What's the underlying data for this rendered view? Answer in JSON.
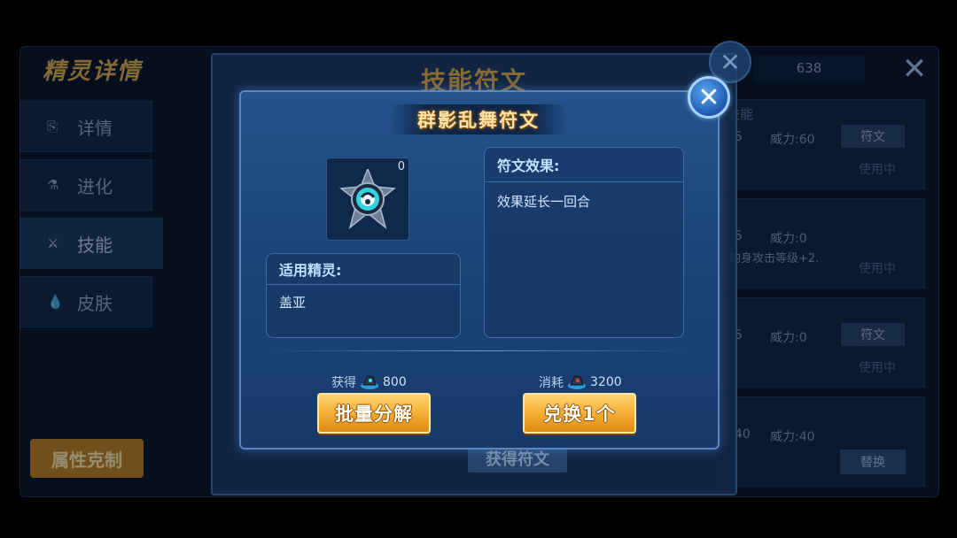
{
  "background": {
    "page_title": "精灵详情",
    "sidebar": [
      {
        "icon": "document-icon",
        "glyph": "⎘",
        "label": "详情"
      },
      {
        "icon": "flask-icon",
        "glyph": "⚗",
        "label": "进化"
      },
      {
        "icon": "sword-icon",
        "glyph": "⚔",
        "label": "技能",
        "active": true
      },
      {
        "icon": "drop-icon",
        "glyph": "💧",
        "label": "皮肤"
      }
    ],
    "attribute_button": "属性克制",
    "count_display": "638",
    "skill_head": "技能",
    "skill_cards": [
      {
        "col1": "5",
        "col2": "威力:60",
        "button": "符文",
        "status": "使用中",
        "extra": ""
      },
      {
        "col1": "5",
        "col2": "威力:0",
        "button": "",
        "status": "使用中",
        "extra": "的身攻击等级+2."
      },
      {
        "col1": "5",
        "col2": "威力:0",
        "button": "符文",
        "status": "使用中",
        "extra": ""
      },
      {
        "col1": "40",
        "col2": "威力:40",
        "button": "",
        "status": "",
        "extra": ""
      }
    ],
    "dismantle_button": "替换"
  },
  "mid_dialog": {
    "title": "技能符文",
    "get_rune_button": "获得符文"
  },
  "rune_dialog": {
    "title": "群影乱舞符文",
    "rune_count": "0",
    "applicable_label": "适用精灵:",
    "applicable_value": "盖亚",
    "effect_label": "符文效果:",
    "effect_value": "效果延长一回合",
    "obtain_label": "获得",
    "obtain_amount": "800",
    "cost_label": "消耗",
    "cost_amount": "3200",
    "decompose_button": "批量分解",
    "exchange_button": "兑换1个"
  },
  "colors": {
    "accent_gold": "#f7b23a",
    "dialog_blue": "#1c4478",
    "title_glow": "#ffe2a8"
  }
}
